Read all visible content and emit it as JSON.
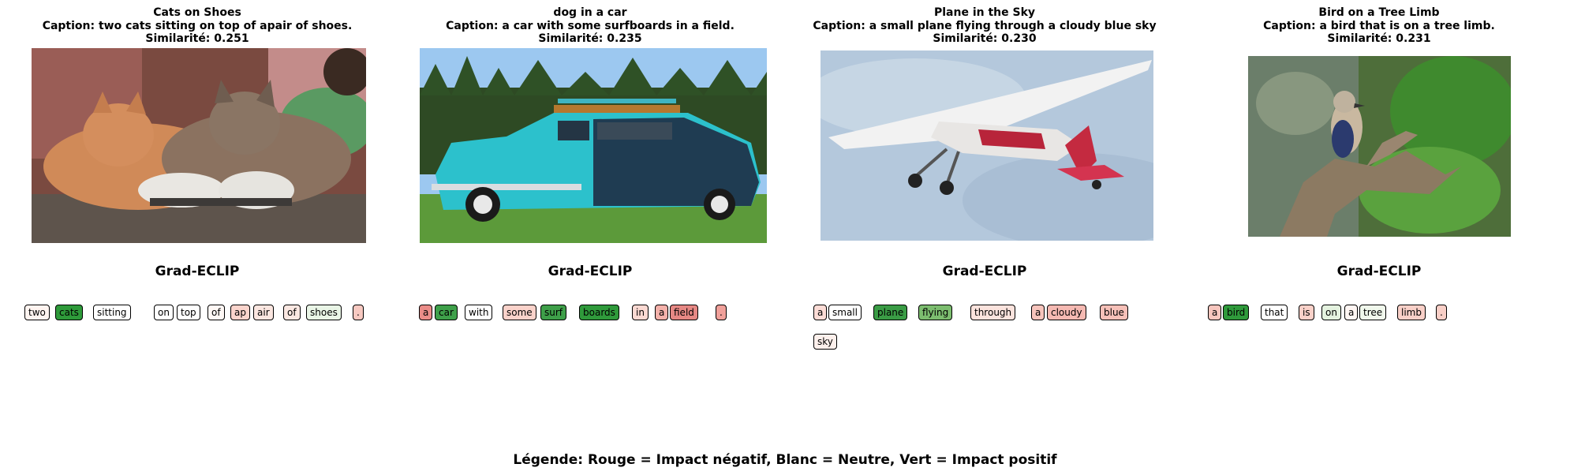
{
  "panels": [
    {
      "name": "Cats on Shoes",
      "caption_line": "Caption: two cats sitting on top of apair of shoes.",
      "similarity_line": "Similarité: 0.251",
      "image_desc": "two-cats-on-shoes-photo",
      "method": "Grad-ECLIP",
      "tokens": [
        {
          "t": "two",
          "c": "#fff4f0"
        },
        {
          "t": "cats",
          "c": "#2e9a3a"
        },
        {
          "t": "sitting",
          "c": "#ffffff"
        },
        {
          "t": "on",
          "c": "#ffffff"
        },
        {
          "t": "top",
          "c": "#ffffff"
        },
        {
          "t": "of",
          "c": "#fff8f5"
        },
        {
          "t": "ap",
          "c": "#fad4cc"
        },
        {
          "t": "air",
          "c": "#fbe6e0"
        },
        {
          "t": "of",
          "c": "#fbe8e2"
        },
        {
          "t": "shoes",
          "c": "#e9f5e6"
        },
        {
          "t": ".",
          "c": "#f7c9c1"
        }
      ]
    },
    {
      "name": "dog in a car",
      "caption_line": "Caption: a car with some surfboards in a field.",
      "similarity_line": "Similarité: 0.235",
      "image_desc": "turquoise-vintage-car-photo",
      "method": "Grad-ECLIP",
      "tokens": [
        {
          "t": "a",
          "c": "#ea8c88"
        },
        {
          "t": "car",
          "c": "#3ea04a"
        },
        {
          "t": "with",
          "c": "#ffffff"
        },
        {
          "t": "some",
          "c": "#fad2ca"
        },
        {
          "t": "surf",
          "c": "#3e9f49"
        },
        {
          "t": "boards",
          "c": "#2f9a3b"
        },
        {
          "t": "in",
          "c": "#fbd9d2"
        },
        {
          "t": "a",
          "c": "#f4b1aa"
        },
        {
          "t": "field",
          "c": "#e68884"
        },
        {
          "t": ".",
          "c": "#f0a09a"
        }
      ]
    },
    {
      "name": "Plane in the Sky",
      "caption_line": "Caption: a small plane flying through a cloudy blue sky",
      "similarity_line": "Similarité: 0.230",
      "image_desc": "small-plane-in-sky-photo",
      "method": "Grad-ECLIP",
      "tokens": [
        {
          "t": "a",
          "c": "#fcdcd6"
        },
        {
          "t": "small",
          "c": "#ffffff"
        },
        {
          "t": "plane",
          "c": "#3a9c45"
        },
        {
          "t": "flying",
          "c": "#7cbd6f"
        },
        {
          "t": "through",
          "c": "#fbe3dd"
        },
        {
          "t": "a",
          "c": "#f7c4bc"
        },
        {
          "t": "cloudy",
          "c": "#f5b9b2"
        },
        {
          "t": "blue",
          "c": "#f6c0b8"
        },
        {
          "t": "sky",
          "c": "#fdf0ec"
        }
      ]
    },
    {
      "name": "Bird on a Tree Limb",
      "caption_line": "Caption: a bird that is on a tree limb.",
      "similarity_line": "Similarité: 0.231",
      "image_desc": "bird-on-tree-limb-photo",
      "method": "Grad-ECLIP",
      "tokens": [
        {
          "t": "a",
          "c": "#f7c6be"
        },
        {
          "t": "bird",
          "c": "#2f9a3b"
        },
        {
          "t": "that",
          "c": "#ffffff"
        },
        {
          "t": "is",
          "c": "#fad1c9"
        },
        {
          "t": "on",
          "c": "#e4f2df"
        },
        {
          "t": "a",
          "c": "#fff6f3"
        },
        {
          "t": "tree",
          "c": "#f0f8ec"
        },
        {
          "t": "limb",
          "c": "#f9d0c8"
        },
        {
          "t": ".",
          "c": "#f9cfc7"
        }
      ]
    }
  ],
  "legend": "Légende: Rouge = Impact négatif, Blanc = Neutre, Vert = Impact positif"
}
